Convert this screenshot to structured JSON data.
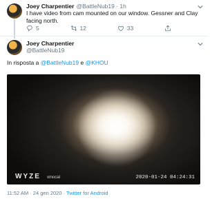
{
  "tweet1": {
    "name": "Joey Charpentier",
    "handle_time": "@BattleNub19 · 1h",
    "text": "I have video from cam mounted on our window. Gessner and Clay facing north.",
    "replies": "5",
    "retweets": "12",
    "likes": "33"
  },
  "tweet2": {
    "name": "Joey Charpentier",
    "handle": "@BattleNub19",
    "reply_prefix": "In risposta a",
    "reply_handle1": "@BattleNub19",
    "reply_and": "e",
    "reply_handle2": "@KHOU",
    "video": {
      "brand": "WYZE",
      "brand_sub": "xmocal",
      "timestamp": "2020-01-24  04:24:31"
    },
    "meta": "11:52 AM · 24 gen 2020 · ",
    "source": "Twitter for Android"
  },
  "icons": {
    "reply": "reply-icon",
    "retweet": "retweet-icon",
    "like": "heart-icon",
    "share": "share-icon",
    "more": "chevron-down-icon"
  },
  "colors": {
    "link": "#1b95e0",
    "secondary_text": "#657786"
  }
}
